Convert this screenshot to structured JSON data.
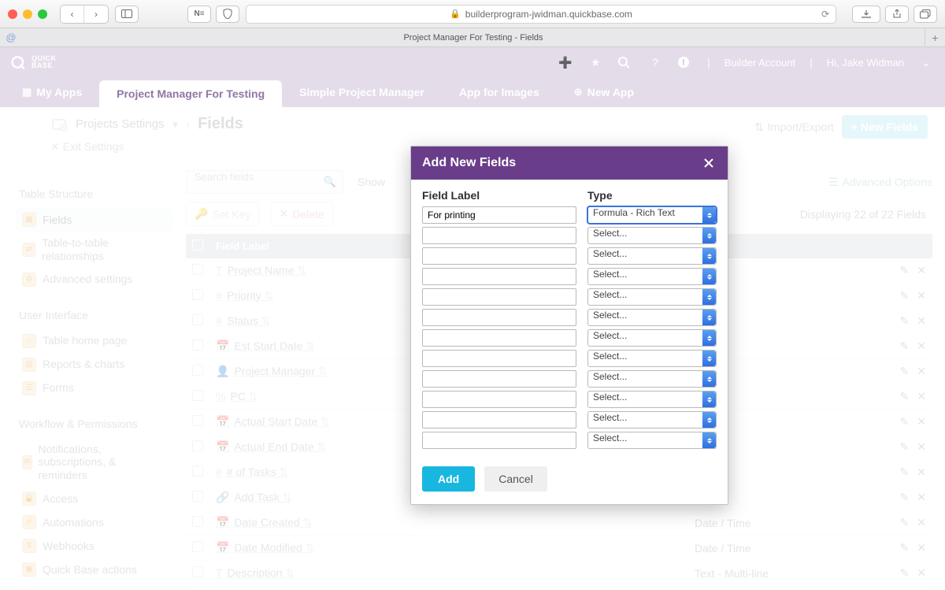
{
  "browser": {
    "url": "builderprogram-jwidman.quickbase.com",
    "tab_title": "Project Manager For Testing - Fields"
  },
  "topbar": {
    "builder_account": "Builder Account",
    "greeting": "Hi, Jake Widman"
  },
  "apptabs": {
    "myapps": "My Apps",
    "active": "Project Manager For Testing",
    "spm": "Simple Project Manager",
    "images": "App for Images",
    "newapp": "New App"
  },
  "crumb": {
    "settings": "Projects Settings",
    "title": "Fields",
    "exit": "Exit Settings",
    "import": "Import/Export",
    "new_fields": "+ New Fields"
  },
  "sidebar": {
    "sec1": "Table Structure",
    "fields": "Fields",
    "rel": "Table-to-table relationships",
    "adv": "Advanced settings",
    "sec2": "User Interface",
    "home": "Table home page",
    "reports": "Reports & charts",
    "forms": "Forms",
    "sec3": "Workflow & Permissions",
    "notif": "Notifications, subscriptions, & reminders",
    "access": "Access",
    "auto": "Automations",
    "web": "Webhooks",
    "qba": "Quick Base actions"
  },
  "toolbar": {
    "search_ph": "Search fields",
    "show": "Show",
    "advanced": "Advanced Options",
    "setkey": "Set Key",
    "delete": "Delete",
    "displaying": "Displaying 22 of 22 Fields",
    "header": "Field Label"
  },
  "rows": [
    {
      "icon": "T",
      "label": "Project Name",
      "type": ""
    },
    {
      "icon": "≡",
      "label": "Priority",
      "type": ""
    },
    {
      "icon": "≡",
      "label": "Status",
      "type": ""
    },
    {
      "icon": "📅",
      "label": "Est Start Date",
      "type": ""
    },
    {
      "icon": "👤",
      "label": "Project Manager",
      "type": ""
    },
    {
      "icon": "%",
      "label": "PC",
      "type": ""
    },
    {
      "icon": "📅",
      "label": "Actual Start Date",
      "type": ""
    },
    {
      "icon": "📅",
      "label": "Actual End Date",
      "type": ""
    },
    {
      "icon": "#",
      "label": "# of Tasks",
      "type": ""
    },
    {
      "icon": "🔗",
      "label": "Add Task",
      "type": ""
    },
    {
      "icon": "📅",
      "label": "Date Created",
      "type": "Date / Time"
    },
    {
      "icon": "📅",
      "label": "Date Modified",
      "type": "Date / Time"
    },
    {
      "icon": "T",
      "label": "Description",
      "type": "Text - Multi-line"
    }
  ],
  "modal": {
    "title": "Add New Fields",
    "h_label": "Field Label",
    "h_type": "Type",
    "add": "Add",
    "cancel": "Cancel",
    "select_ph": "Select...",
    "rows": [
      {
        "label": "For printing",
        "type": "Formula - Rich Text"
      },
      {
        "label": "",
        "type": "Select..."
      },
      {
        "label": "",
        "type": "Select..."
      },
      {
        "label": "",
        "type": "Select..."
      },
      {
        "label": "",
        "type": "Select..."
      },
      {
        "label": "",
        "type": "Select..."
      },
      {
        "label": "",
        "type": "Select..."
      },
      {
        "label": "",
        "type": "Select..."
      },
      {
        "label": "",
        "type": "Select..."
      },
      {
        "label": "",
        "type": "Select..."
      },
      {
        "label": "",
        "type": "Select..."
      },
      {
        "label": "",
        "type": "Select..."
      }
    ]
  }
}
